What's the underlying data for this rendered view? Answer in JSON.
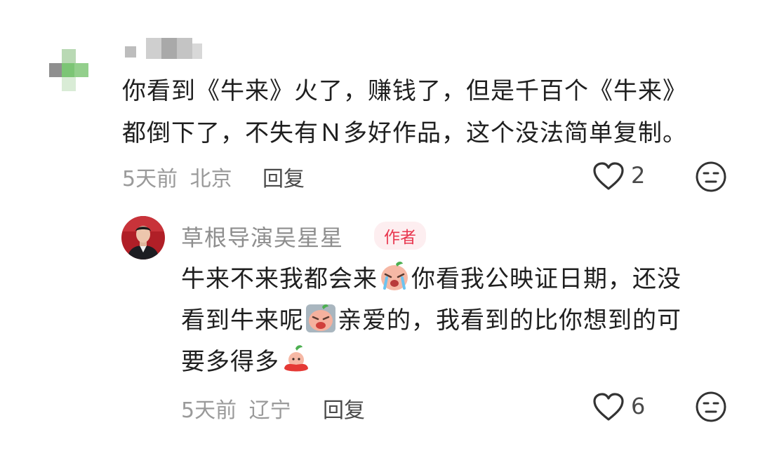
{
  "comment": {
    "line1": "你看到《牛来》火了，赚钱了，但是千百个《牛来》",
    "line2": "都倒下了，不失有Ｎ多好作品，这个没法简单复制。",
    "date": "5天前",
    "location": "北京",
    "reply_label": "回复",
    "likes": "2"
  },
  "reply": {
    "author_name": "草根导演吴星星",
    "badge": "作者",
    "line1_a": "牛来不来我都会来",
    "line1_b": "你看我公映证日期，还没",
    "line2_a": "看到牛来呢",
    "line2_b": "亲爱的，我看到的比你想到的可",
    "line3_a": "要多得多",
    "date": "5天前",
    "location": "辽宁",
    "reply_label": "回复",
    "likes": "6"
  },
  "icons": {
    "like": "heart-outline-icon",
    "dislike": "meh-face-icon",
    "emoji_1": "crying-emoji",
    "emoji_2": "sobbing-emoji",
    "emoji_3": "bean-sprout-emoji"
  },
  "colors": {
    "accent_badge": "#e8374f",
    "badge_bg": "#fdeef0",
    "meta_text": "#9a9a9a"
  }
}
